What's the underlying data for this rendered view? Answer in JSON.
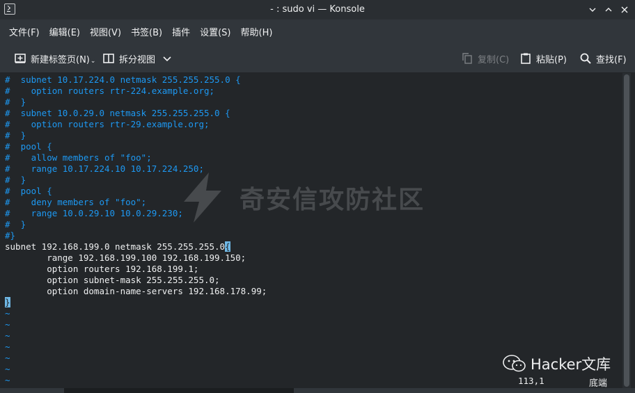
{
  "window": {
    "title": "- : sudo vi — Konsole"
  },
  "menu": [
    "文件(F)",
    "编辑(E)",
    "视图(V)",
    "书签(B)",
    "插件",
    "设置(S)",
    "帮助(H)"
  ],
  "toolbar": {
    "new_tab": "新建标签页(N)",
    "split_view": "拆分视图",
    "copy": "复制(C)",
    "paste": "粘贴(P)",
    "find": "查找(F)"
  },
  "editor": {
    "comment_lines": [
      "#  subnet 10.17.224.0 netmask 255.255.255.0 {",
      "#    option routers rtr-224.example.org;",
      "#  }",
      "#  subnet 10.0.29.0 netmask 255.255.255.0 {",
      "#    option routers rtr-29.example.org;",
      "#  }",
      "#  pool {",
      "#    allow members of \"foo\";",
      "#    range 10.17.224.10 10.17.224.250;",
      "#  }",
      "#  pool {",
      "#    deny members of \"foo\";",
      "#    range 10.0.29.10 10.0.29.230;",
      "#  }",
      "#}"
    ],
    "subnet_line": "subnet 192.168.199.0 netmask 255.255.255.0",
    "subnet_brace": "{",
    "body_lines": [
      "        range 192.168.199.100 192.168.199.150;",
      "        option routers 192.168.199.1;",
      "        option subnet-mask 255.255.255.0;",
      "        option domain-name-servers 192.168.178.99;"
    ],
    "closing_brace": "}",
    "tildes": [
      "~",
      "~",
      "~",
      "~",
      "~",
      "~",
      "~"
    ]
  },
  "status": {
    "position": "113,1",
    "location": "底端"
  },
  "watermark": {
    "text": "奇安信攻防社区",
    "brand": "Hacker文库"
  },
  "colors": {
    "comment": "#1d99f3",
    "cursor": "#6fb8e6",
    "background": "#232629"
  }
}
